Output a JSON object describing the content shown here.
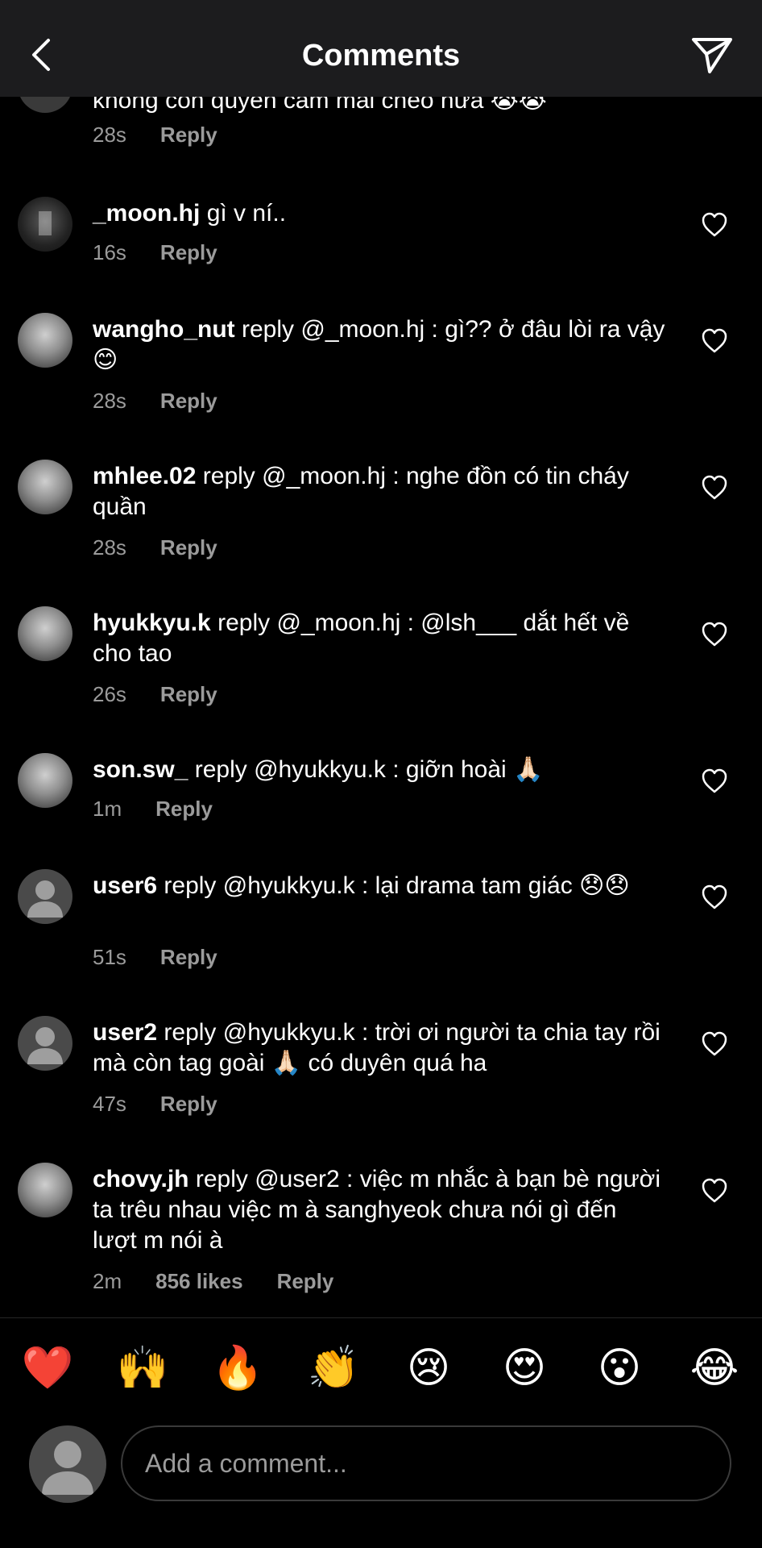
{
  "header": {
    "title": "Comments",
    "back_icon": "chevron-left-icon",
    "share_icon": "paper-plane-icon"
  },
  "clipped_comment": {
    "text": "không còn quyền cầm mái chèo nữa 😭😭",
    "time": "28s",
    "reply_label": "Reply"
  },
  "comments": [
    {
      "username": "_moon.hj",
      "text": "gì v ní..",
      "time": "16s",
      "reply_label": "Reply",
      "avatar": "photo"
    },
    {
      "username": "wangho_nut",
      "text": "reply @_moon.hj : gì?? ở đâu lòi ra vậy 😊",
      "time": "28s",
      "reply_label": "Reply",
      "avatar": "photo"
    },
    {
      "username": "mhlee.02",
      "text": "reply @_moon.hj : nghe đồn có tin cháy quần",
      "time": "28s",
      "reply_label": "Reply",
      "avatar": "photo"
    },
    {
      "username": "hyukkyu.k",
      "text": "reply @_moon.hj : @lsh___ dắt hết về cho tao",
      "time": "26s",
      "reply_label": "Reply",
      "avatar": "photo"
    },
    {
      "username": "son.sw_",
      "text": "reply @hyukkyu.k : giỡn hoài 🙏🏻",
      "time": "1m",
      "reply_label": "Reply",
      "avatar": "photo"
    },
    {
      "username": "user6",
      "text": "reply @hyukkyu.k : lại drama tam giác 😞😞",
      "time": "51s",
      "reply_label": "Reply",
      "avatar": "default"
    },
    {
      "username": "user2",
      "text": "reply @hyukkyu.k : trời ơi người ta chia tay rồi mà còn tag goài 🙏🏻 có duyên quá ha",
      "time": "47s",
      "reply_label": "Reply",
      "avatar": "default"
    },
    {
      "username": "chovy.jh",
      "text": "reply @user2 : việc m nhắc à bạn bè người ta trêu nhau việc m à sanghyeok chưa nói gì đến lượt m nói à",
      "time": "2m",
      "likes": "856 likes",
      "reply_label": "Reply",
      "avatar": "photo"
    }
  ],
  "emoji_bar": [
    "❤️",
    "🙌",
    "🔥",
    "👏",
    "😢",
    "😍",
    "😮",
    "😂"
  ],
  "compose": {
    "placeholder": "Add a comment..."
  },
  "colors": {
    "background": "#000000",
    "header": "#1c1c1e",
    "secondary_text": "#9b9b9b"
  }
}
